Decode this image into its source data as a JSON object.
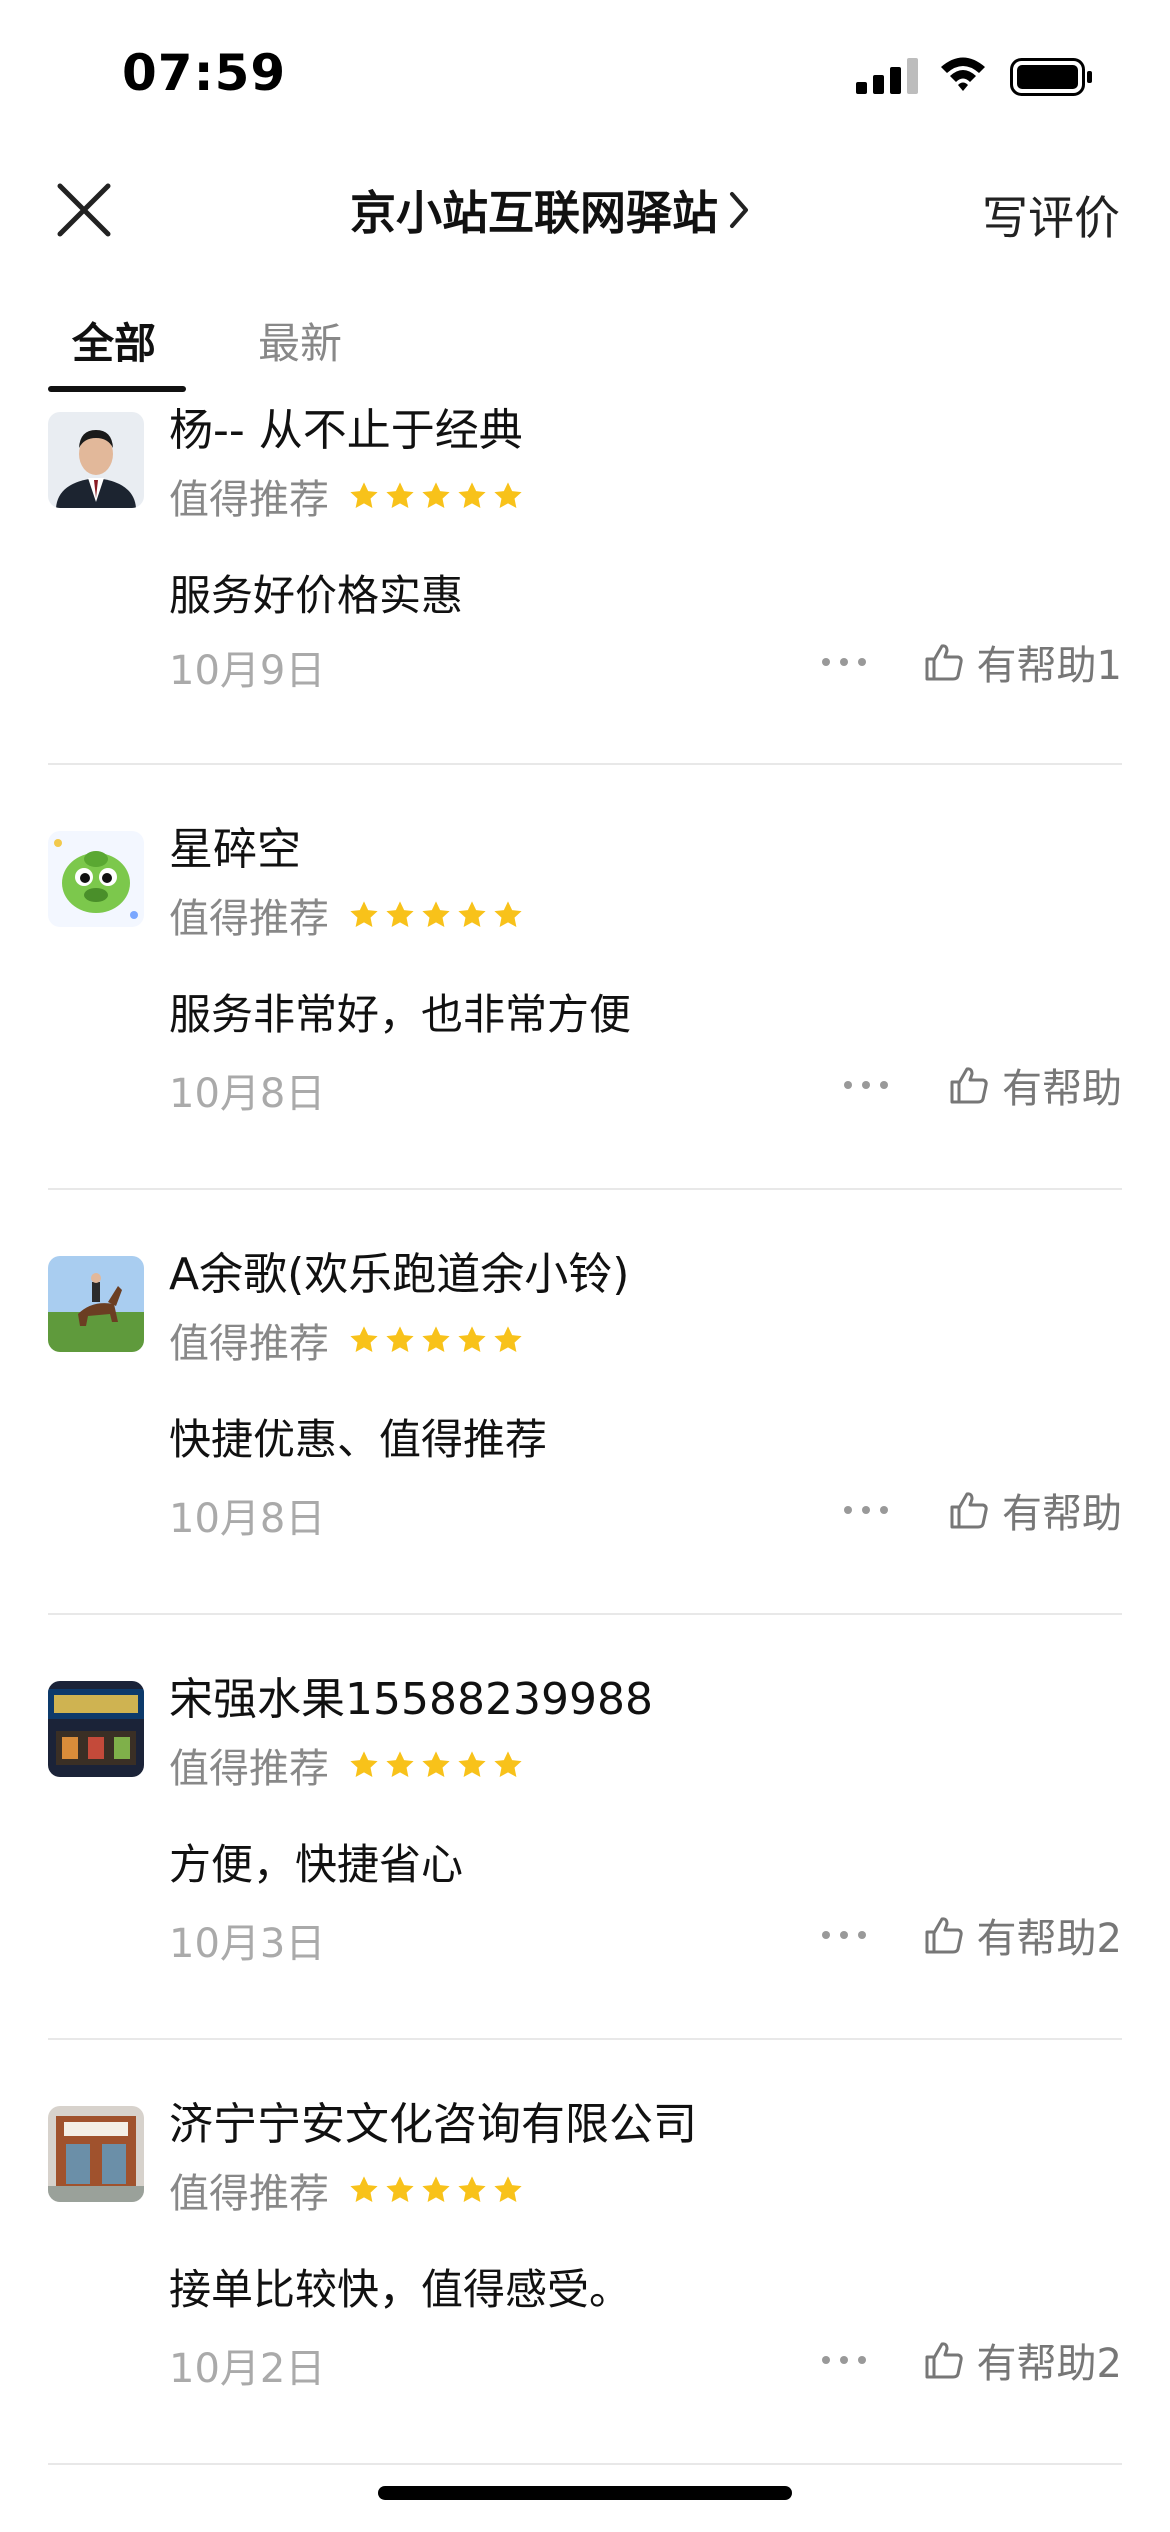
{
  "status_bar": {
    "time": "07:59"
  },
  "header": {
    "title": "京小站互联网驿站",
    "write_review": "写评价"
  },
  "tabs": [
    {
      "label": "全部",
      "active": true
    },
    {
      "label": "最新",
      "active": false
    }
  ],
  "colors": {
    "star": "#F8C21A",
    "accent": "#111111",
    "muted": "#888888"
  },
  "reviews": [
    {
      "name": "杨-- 从不止于经典",
      "rating_label": "值得推荐",
      "stars": 5,
      "text": "服务好价格实惠",
      "date": "10月9日",
      "helpful": "有帮助1"
    },
    {
      "name": "星碎空",
      "rating_label": "值得推荐",
      "stars": 5,
      "text": "服务非常好，也非常方便",
      "date": "10月8日",
      "helpful": "有帮助"
    },
    {
      "name": "A余歌(欢乐跑道余小铃)",
      "rating_label": "值得推荐",
      "stars": 5,
      "text": "快捷优惠、值得推荐",
      "date": "10月8日",
      "helpful": "有帮助"
    },
    {
      "name": "宋强水果15588239988",
      "rating_label": "值得推荐",
      "stars": 5,
      "text": "方便，快捷省心",
      "date": "10月3日",
      "helpful": "有帮助2"
    },
    {
      "name": "济宁宁安文化咨询有限公司",
      "rating_label": "值得推荐",
      "stars": 5,
      "text": "接单比较快，值得感受。",
      "date": "10月2日",
      "helpful": "有帮助2"
    }
  ]
}
